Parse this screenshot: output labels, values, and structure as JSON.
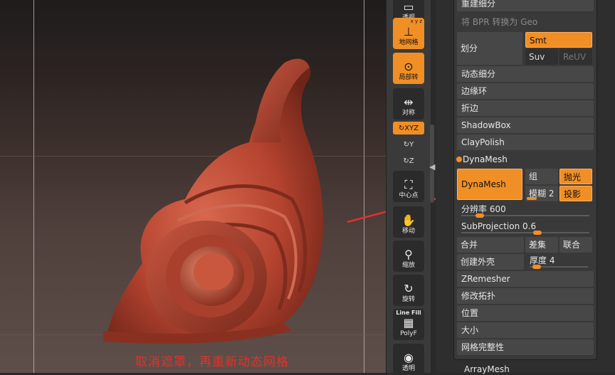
{
  "viewport": {
    "caption": "取消遮罩，再重新动态网格"
  },
  "shelf": {
    "tools": [
      {
        "name": "perspective",
        "label": "透视",
        "icon": "perspective-icon",
        "active": false
      },
      {
        "name": "floor",
        "label": "地网格",
        "icon": "floor-grid-icon",
        "active": true,
        "badge": "x y z"
      },
      {
        "name": "local",
        "label": "局部转",
        "icon": "local-rotate-icon",
        "active": true
      },
      {
        "name": "symmetry",
        "label": "对称",
        "icon": "symmetry-icon",
        "active": false
      },
      {
        "name": "center",
        "label": "中心点",
        "icon": "center-point-icon",
        "active": false
      },
      {
        "name": "move",
        "label": "移动",
        "icon": "move-hand-icon",
        "active": false
      },
      {
        "name": "scale",
        "label": "缩放",
        "icon": "zoom-magnifier-icon",
        "active": false
      },
      {
        "name": "rotate",
        "label": "旋转",
        "icon": "rotate-icon",
        "active": false
      },
      {
        "name": "polyf",
        "label": "PolyF",
        "title": "Line Fill",
        "icon": "polyframe-grid-icon",
        "active": false
      },
      {
        "name": "transparent",
        "label": "透明",
        "icon": "transparency-icon",
        "active": false
      }
    ],
    "axis_toggles": [
      {
        "label": "↻XYZ",
        "active": true
      },
      {
        "label": "↻Y",
        "active": false
      },
      {
        "label": "↻Z",
        "active": false
      }
    ]
  },
  "panel": {
    "rebuild_subdiv": "重建细分",
    "convert_bpr": "将 BPR 转换为 Geo",
    "divide": "划分",
    "smt": "Smt",
    "suv": "Suv",
    "reuv": "ReUV",
    "dynamic_subdiv": "动态细分",
    "edge_loop": "边缘环",
    "crease": "折边",
    "shadowbox": "ShadowBox",
    "claypolish": "ClayPolish",
    "dynamesh_header": "DynaMesh",
    "dynamesh_btn": "DynaMesh",
    "group": "组",
    "polish": "抛光",
    "blur_label": "模糊",
    "blur_value": "2",
    "project": "投影",
    "resolution_label": "分辨率",
    "resolution_value": "600",
    "resolution_fraction": 0.12,
    "subprojection_label": "SubProjection",
    "subprojection_value": "0.6",
    "subprojection_fraction": 0.6,
    "merge": "合并",
    "subtract": "差集",
    "union": "联合",
    "create_shell": "创建外壳",
    "thickness_label": "厚度",
    "thickness_value": "4",
    "thickness_fraction": 0.05,
    "zremesher": "ZRemesher",
    "modify_topo": "修改拓扑",
    "position": "位置",
    "size": "大小",
    "mesh_integrity": "网格完整性",
    "arraymesh": "ArrayMesh"
  },
  "colors": {
    "accent": "#f08f25",
    "caption": "#e0322a",
    "model": "#b4432f"
  }
}
